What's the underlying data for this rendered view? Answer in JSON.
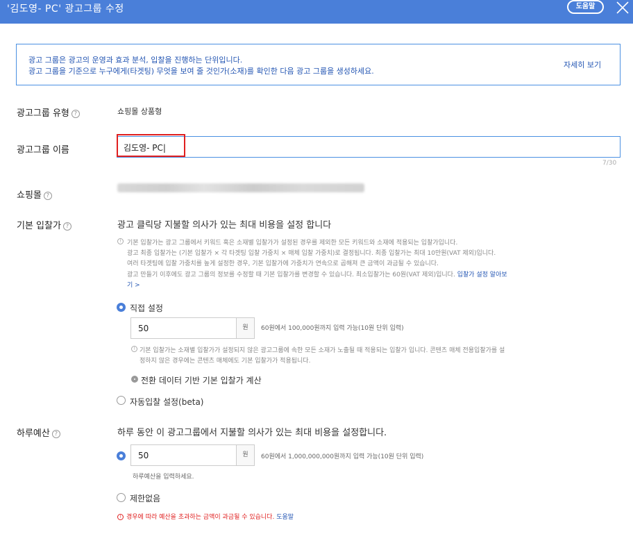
{
  "header": {
    "title": "'김도영- PC' 광고그룹 수정",
    "help_label": "도움말"
  },
  "info": {
    "line1": "광고 그룹은 광고의 운영과 효과 분석, 입찰을 진행하는 단위입니다.",
    "line2": "광고 그룹을 기준으로 누구에게(타겟팅) 무엇을 보여 줄 것인가(소재)를 확인한 다음 광고 그룹을 생성하세요.",
    "more_label": "자세히 보기"
  },
  "group_type": {
    "label": "광고그룹 유형",
    "value": "쇼핑몰 상품형"
  },
  "group_name": {
    "label": "광고그룹 이름",
    "value": "김도영- PC|",
    "count": "7/30"
  },
  "shop": {
    "label": "쇼핑몰"
  },
  "bid": {
    "label": "기본 입찰가",
    "desc": "광고 클릭당 지불할 의사가 있는 최대 비용을 설정 합니다",
    "notes": [
      "기본 입찰가는 광고 그룹에서 키워드 혹은 소재별 입찰가가 설정된 경우를 제외한 모든 키워드와 소재에 적용되는 입찰가입니다.",
      "광고 최종 입찰가는 (기본 입찰가 × 각 타겟팅 입찰 가중치 × 매체 입찰 가중치)로 결정됩니다. 최종 입찰가는 최대 10만원(VAT 제외)입니다.",
      "여러 타겟팅에 입찰 가중치를 높게 설정한 경우, 기본 입찰가에 가중치가 연속으로 곱해져 큰 금액이 과금될 수 있습니다.",
      "광고 만들기 이후에도 광고 그룹의 정보를 수정할 때 기본 입찰가를 변경할 수 있습니다. 최소입찰가는 60원(VAT 제외)입니다."
    ],
    "note_link_a": "입찰가 설정 알아보",
    "note_link_b": "기 >",
    "direct_label": "직접 설정",
    "direct_value": "50",
    "unit": "원",
    "range_hint": "60원에서 100,000원까지 입력 가능(10원 단위 입력)",
    "sub_note1": "기본 입찰가는 소재별 입찰가가 설정되지 않은 광고그룹에 속한 모든 소재가 노출될 때 적용되는 입찰가 입니다. 콘텐츠 매체 전용입찰가를 설",
    "sub_note2": "정하지 않은 경우에는 콘텐츠 매체에도 기본 입찰가가 적용됩니다.",
    "conv_label": "전환 데이터 기반 기본 입찰가 계산",
    "auto_label": "자동입찰 설정(beta)"
  },
  "budget": {
    "label": "하루예산",
    "desc": "하루 동안 이 광고그룹에서 지불할 의사가 있는 최대 비용을 설정합니다.",
    "value": "50",
    "unit": "원",
    "range_hint": "60원에서 1,000,000,000원까지 입력 가능(10원 단위 입력)",
    "input_hint": "하루예산을 입력하세요.",
    "unlimited_label": "제한없음",
    "warning": "경우에 따라 예산을 초과하는 금액이 과금될 수 있습니다.",
    "warning_link": "도움말"
  },
  "icons": [
    "close-icon",
    "question-icon",
    "info-icon",
    "warning-icon"
  ],
  "colors": {
    "header": "#4a7fd9",
    "accent": "#4a90e2",
    "highlight": "#e01f1f",
    "warning": "#e02020",
    "link": "#2456b3"
  }
}
